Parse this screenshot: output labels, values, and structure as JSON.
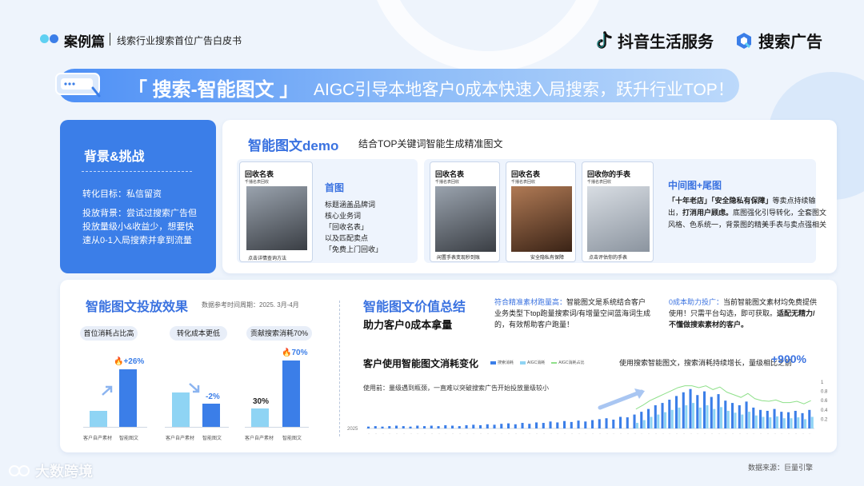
{
  "header": {
    "section": "案例篇",
    "subtitle": "线索行业搜索首位广告白皮书",
    "brand1": "抖音生活服务",
    "brand2": "搜索广告"
  },
  "banner": {
    "title": "「 搜索-智能图文 」",
    "tagline": "AIGC引导本地客户0成本快速入局搜索，跃升行业TOP！"
  },
  "background_card": {
    "title": "背景&挑战",
    "goal": "转化目标：私信留资",
    "background": "投放背景：尝试过搜索广告但投放量级小&收益少，想要快速从0-1入局搜索并拿到流量"
  },
  "demo": {
    "title": "智能图文demo",
    "subtitle": "结合TOP关键词智能生成精准图文",
    "first": {
      "title": "首图",
      "lines": [
        "标题涵盖品牌词",
        "核心业务词",
        "「回收名表」",
        "以及匹配卖点",
        "「免费上门回收」"
      ]
    },
    "middle": {
      "title": "中间图+尾图",
      "desc_a": "「十年老店」「安全隐私有保障」",
      "desc_b": "等卖点持续输出，",
      "desc_c": "打消用户顾虑。",
      "desc_d": "底图强化引导转化，全套图文风格、色系统一，背景图的精美手表与卖点强相关"
    },
    "phones": [
      {
        "title": "回收名表",
        "sub": "千播名表回收",
        "foot": "点击详情查询方法"
      },
      {
        "title": "回收名表",
        "sub": "千播名表回收",
        "foot": "闲置手表变现秒到账"
      },
      {
        "title": "回收名表",
        "sub": "千播名表回收",
        "foot": "安全隐私有保障"
      },
      {
        "title": "回收你的手表",
        "sub": "千播名表回收",
        "foot": "点击评估你的手表"
      }
    ]
  },
  "effect": {
    "title": "智能图文投放效果",
    "note": "数据参考时间周期：2025. 3月-4月",
    "groups": [
      {
        "label": "首位消耗占比高",
        "change": "+26%",
        "base": "客户自产素材",
        "new": "智能图文",
        "base_value": 0.3,
        "new_value": 1.0
      },
      {
        "label": "转化成本更低",
        "change": "-2%",
        "base": "客户自产素材",
        "new": "智能图文",
        "base_value": 1.0,
        "new_value": 0.72
      },
      {
        "label": "贡献搜索消耗70%",
        "base_pct": "30%",
        "change": "70%",
        "base": "客户自产素材",
        "new": "智能图文",
        "base_value": 0.3,
        "new_value": 0.7
      }
    ]
  },
  "value": {
    "title": "智能图文价值总结",
    "subtitle": "助力客户0成本拿量",
    "p1_hl": "符合精准素材跑量高：",
    "p1": "智能图文是系统结合客户业务类型下top跑量搜索词/有增量空间蓝海词生成的，有效帮助客户跑量！",
    "p2_hl": "0成本助力投广：",
    "p2": "当前智能图文素材均免费提供使用！只需平台勾选，即可获取。",
    "p2_b": "适配无精力/不懂做搜索素材的客户。"
  },
  "chart_data": {
    "type": "bar",
    "title": "客户使用智能图文消耗变化",
    "legend": [
      "搜索消耗",
      "AIGC消耗",
      "AIGC消耗占比"
    ],
    "note": "使用搜索智能图文，搜索消耗持续增长，量级相比之前",
    "growth": "+900%",
    "before_note": "使用前：量级遇到瓶颈，一直难以突破搜索广告开始投放量级较小",
    "year": "2025",
    "y2_ticks": [
      "1",
      "0.8",
      "0.6",
      "0.4",
      "0.2"
    ],
    "search": [
      0.04,
      0.05,
      0.04,
      0.05,
      0.06,
      0.05,
      0.04,
      0.06,
      0.05,
      0.06,
      0.05,
      0.07,
      0.06,
      0.05,
      0.07,
      0.08,
      0.07,
      0.09,
      0.08,
      0.1,
      0.11,
      0.09,
      0.12,
      0.1,
      0.13,
      0.12,
      0.15,
      0.13,
      0.16,
      0.14,
      0.17,
      0.15,
      0.18,
      0.2,
      0.22,
      0.19,
      0.25,
      0.24,
      0.3,
      0.36,
      0.42,
      0.5,
      0.55,
      0.62,
      0.7,
      0.78,
      0.85,
      0.72,
      0.8,
      0.68,
      0.74,
      0.6,
      0.55,
      0.5,
      0.58,
      0.45,
      0.4,
      0.38,
      0.42,
      0.36,
      0.35,
      0.38,
      0.33,
      0.4
    ],
    "aigc": [
      0,
      0,
      0,
      0,
      0,
      0,
      0,
      0,
      0,
      0,
      0,
      0,
      0,
      0,
      0,
      0,
      0,
      0,
      0,
      0,
      0,
      0,
      0,
      0,
      0,
      0,
      0,
      0,
      0,
      0,
      0,
      0,
      0,
      0,
      0,
      0,
      0,
      0,
      0.12,
      0.18,
      0.25,
      0.3,
      0.35,
      0.4,
      0.45,
      0.5,
      0.55,
      0.45,
      0.5,
      0.42,
      0.46,
      0.38,
      0.34,
      0.3,
      0.36,
      0.28,
      0.25,
      0.24,
      0.26,
      0.22,
      0.22,
      0.24,
      0.2,
      0.25
    ]
  },
  "source": "数据来源：巨量引擎",
  "watermark": "大数跨境",
  "colors": {
    "primary": "#3b7ee8",
    "light": "#8fd4f4",
    "line": "#8fe08a"
  }
}
